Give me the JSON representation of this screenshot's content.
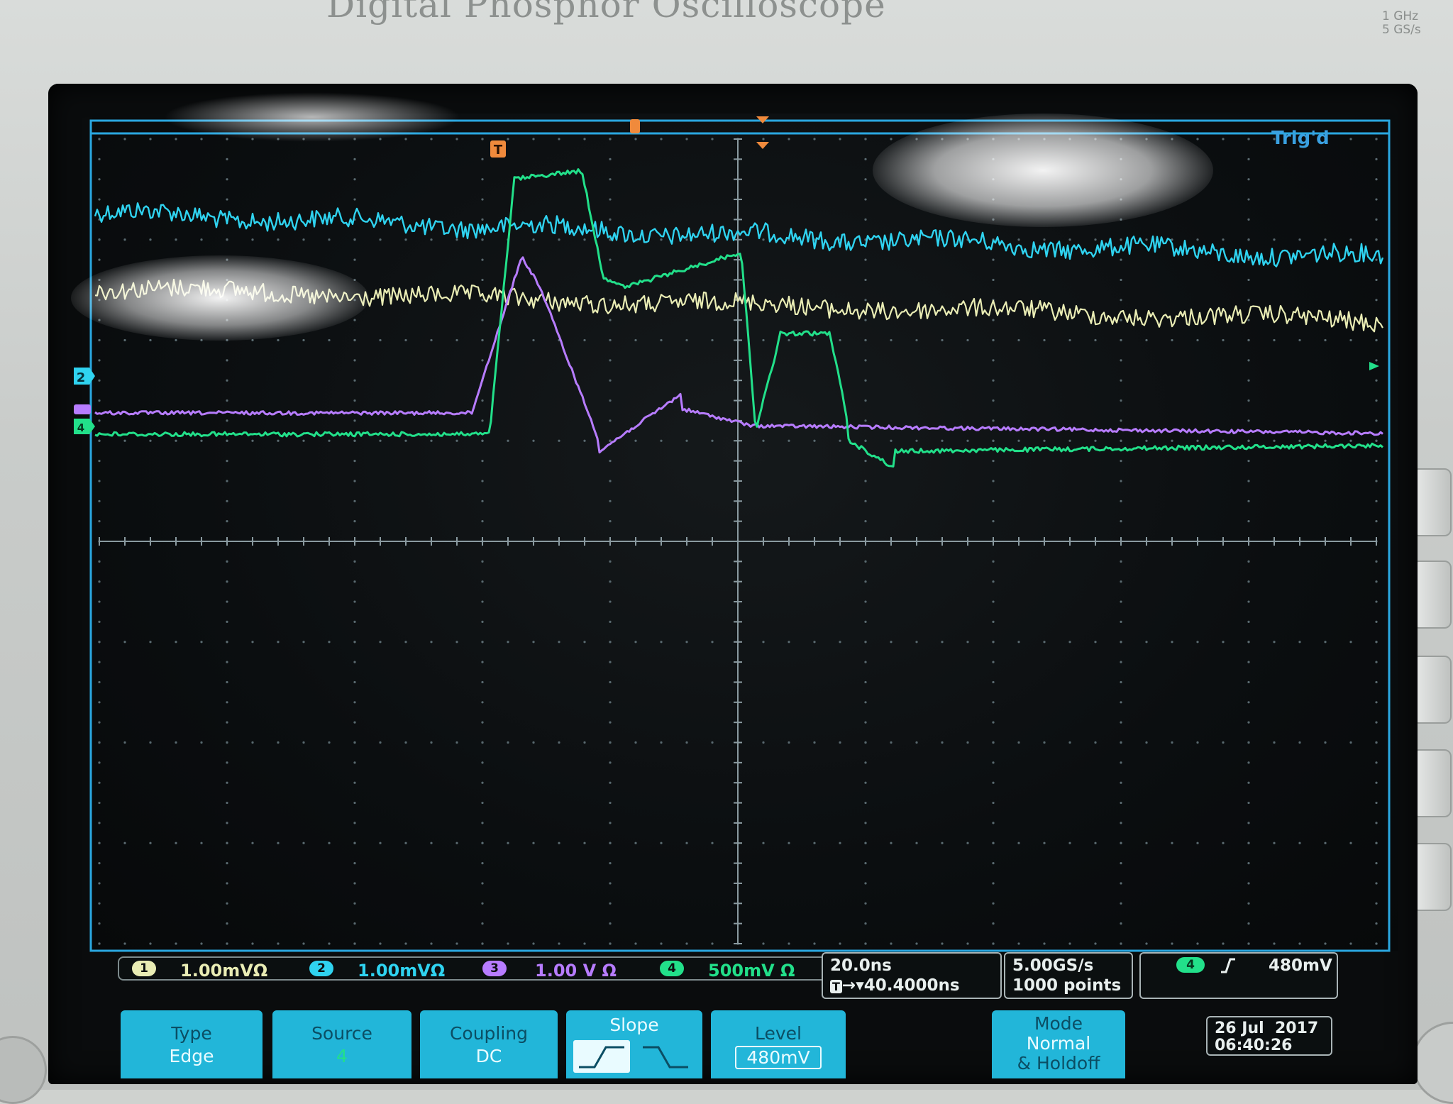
{
  "instrument": {
    "title": "Digital Phosphor Oscilloscope",
    "spec_bandwidth": "1 GHz",
    "spec_rate": "5 GS/s"
  },
  "acquisition": {
    "status": "Trig'd"
  },
  "channels": [
    {
      "id": "1",
      "scale": "1.00mV",
      "unit_mark": "Ω",
      "color": "#e9ecb4"
    },
    {
      "id": "2",
      "scale": "1.00mV",
      "unit_mark": "Ω",
      "color": "#2fd3f0"
    },
    {
      "id": "3",
      "scale": "1.00 V",
      "unit_mark": "Ω",
      "color": "#b77cff"
    },
    {
      "id": "4",
      "scale": "500mV",
      "unit_mark": "Ω",
      "color": "#22e08a"
    }
  ],
  "markers": {
    "trigger": "T",
    "ch2": "2",
    "ch4": "4"
  },
  "timebase": {
    "scale": "20.0ns",
    "position": "→▾40.4000ns",
    "position_icon": "T"
  },
  "sampling": {
    "rate": "5.00GS/s",
    "points": "1000 points"
  },
  "trigger": {
    "source_badge": "4",
    "slope_icon": "rising-edge-icon",
    "level": "480mV"
  },
  "menu": {
    "type": {
      "title": "Type",
      "value": "Edge"
    },
    "source": {
      "title": "Source",
      "value": "4"
    },
    "coupling": {
      "title": "Coupling",
      "value": "DC"
    },
    "slope": {
      "title": "Slope"
    },
    "level": {
      "title": "Level",
      "value": "480mV"
    },
    "mode": {
      "title": "Mode",
      "value": "Normal",
      "value2": "& Holdoff"
    }
  },
  "datetime": {
    "date": "26 Jul  2017",
    "time": "06:40:26"
  },
  "colors": {
    "screen_bg": "#0a0c0d",
    "graticule": "#5a6a70",
    "frame": "#2aa7e0",
    "menu": "#22b6d9"
  }
}
